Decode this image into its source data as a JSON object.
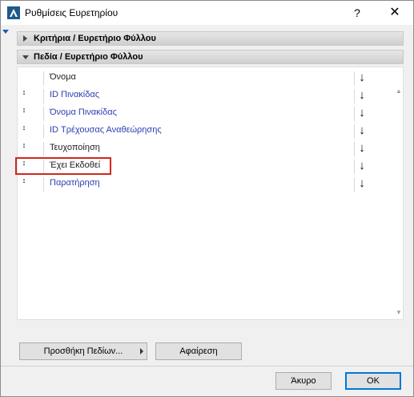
{
  "window": {
    "title": "Ρυθμίσεις Ευρετηρίου",
    "help_label": "?",
    "close_label": "✕"
  },
  "sections": {
    "criteria_label": "Κριτήρια /  Ευρετήριο Φύλλου",
    "fields_label": "Πεδία /  Ευρετήριο Φύλλου"
  },
  "fields": [
    {
      "name": "Όνομα",
      "color": "#222222",
      "draggable": false
    },
    {
      "name": "ID Πινακίδας",
      "color": "#2b3fb0",
      "draggable": true
    },
    {
      "name": "Όνομα Πινακίδας",
      "color": "#2b3fb0",
      "draggable": true
    },
    {
      "name": "ID Τρέχουσας Αναθεώρησης",
      "color": "#2b3fb0",
      "draggable": true
    },
    {
      "name": "Τευχοποίηση",
      "color": "#222222",
      "draggable": true
    },
    {
      "name": "Έχει Εκδοθεί",
      "color": "#222222",
      "draggable": true,
      "highlighted": true
    },
    {
      "name": "Παρατήρηση",
      "color": "#2b3fb0",
      "draggable": true
    }
  ],
  "sort_icon": "↓",
  "drag_icon": "↕",
  "buttons": {
    "add_fields": "Προσθήκη Πεδίων...",
    "remove": "Αφαίρεση",
    "cancel": "Άκυρο",
    "ok": "OK"
  },
  "colors": {
    "highlight": "#d3261e",
    "field_blue": "#2b3fb0",
    "ok_border": "#0078d7"
  }
}
